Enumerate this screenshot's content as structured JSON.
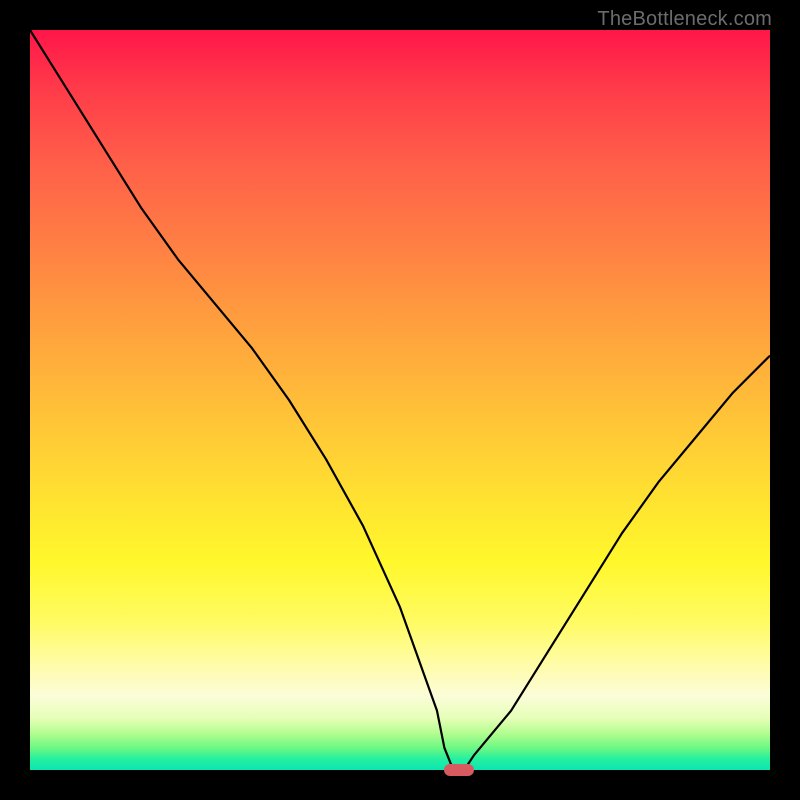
{
  "watermark": "TheBottleneck.com",
  "chart_data": {
    "type": "line",
    "title": "",
    "xlabel": "",
    "ylabel": "",
    "xlim": [
      0,
      100
    ],
    "ylim": [
      0,
      100
    ],
    "x": [
      0,
      5,
      10,
      15,
      20,
      25,
      30,
      35,
      40,
      45,
      50,
      55,
      56,
      57,
      58,
      59,
      60,
      65,
      70,
      75,
      80,
      85,
      90,
      95,
      100
    ],
    "values": [
      100,
      92,
      84,
      76,
      69,
      63,
      57,
      50,
      42,
      33,
      22,
      8,
      3,
      0.5,
      0,
      0.5,
      2,
      8,
      16,
      24,
      32,
      39,
      45,
      51,
      56
    ],
    "marker": {
      "x": 58,
      "y": 0
    },
    "gradient_stops": [
      {
        "pct": 0,
        "color": "#ff1649"
      },
      {
        "pct": 50,
        "color": "#ffc537"
      },
      {
        "pct": 75,
        "color": "#fff82c"
      },
      {
        "pct": 100,
        "color": "#0ae6b4"
      }
    ]
  }
}
